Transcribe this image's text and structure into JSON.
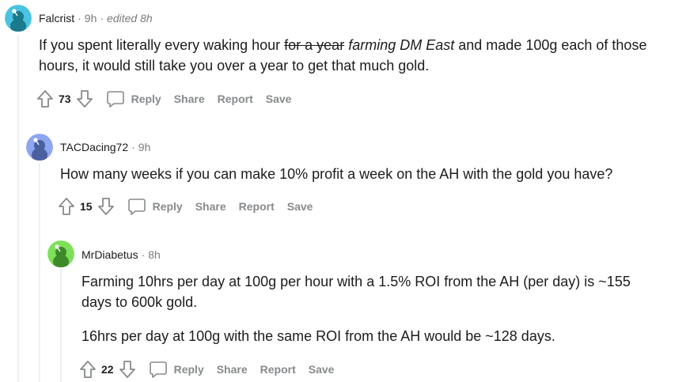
{
  "comments": [
    {
      "author": "Falcrist",
      "age": "9h",
      "edited": "edited 8h",
      "avatar_color": "#49c3e0",
      "body": {
        "before": "If you spent literally every waking hour ",
        "struck": "for a year",
        "italic": "farming DM East",
        "after": " and made 100g each of those hours, it would still take you over a year to get that much gold."
      },
      "score": "73"
    },
    {
      "author": "TACDacing72",
      "age": "9h",
      "avatar_color": "#8ea6f0",
      "body": [
        "How many weeks if you can make 10% profit a week on the AH with the gold you have?"
      ],
      "score": "15"
    },
    {
      "author": "MrDiabetus",
      "age": "8h",
      "avatar_color": "#7ee05a",
      "body": [
        "Farming 10hrs per day at 100g per hour with a 1.5% ROI from the AH (per day) is ~155 days to 600k gold.",
        "16hrs per day at 100g with the same ROI from the AH would be ~128 days."
      ],
      "score": "22"
    }
  ],
  "actions": {
    "reply": "Reply",
    "share": "Share",
    "report": "Report",
    "save": "Save"
  },
  "separator": "·"
}
